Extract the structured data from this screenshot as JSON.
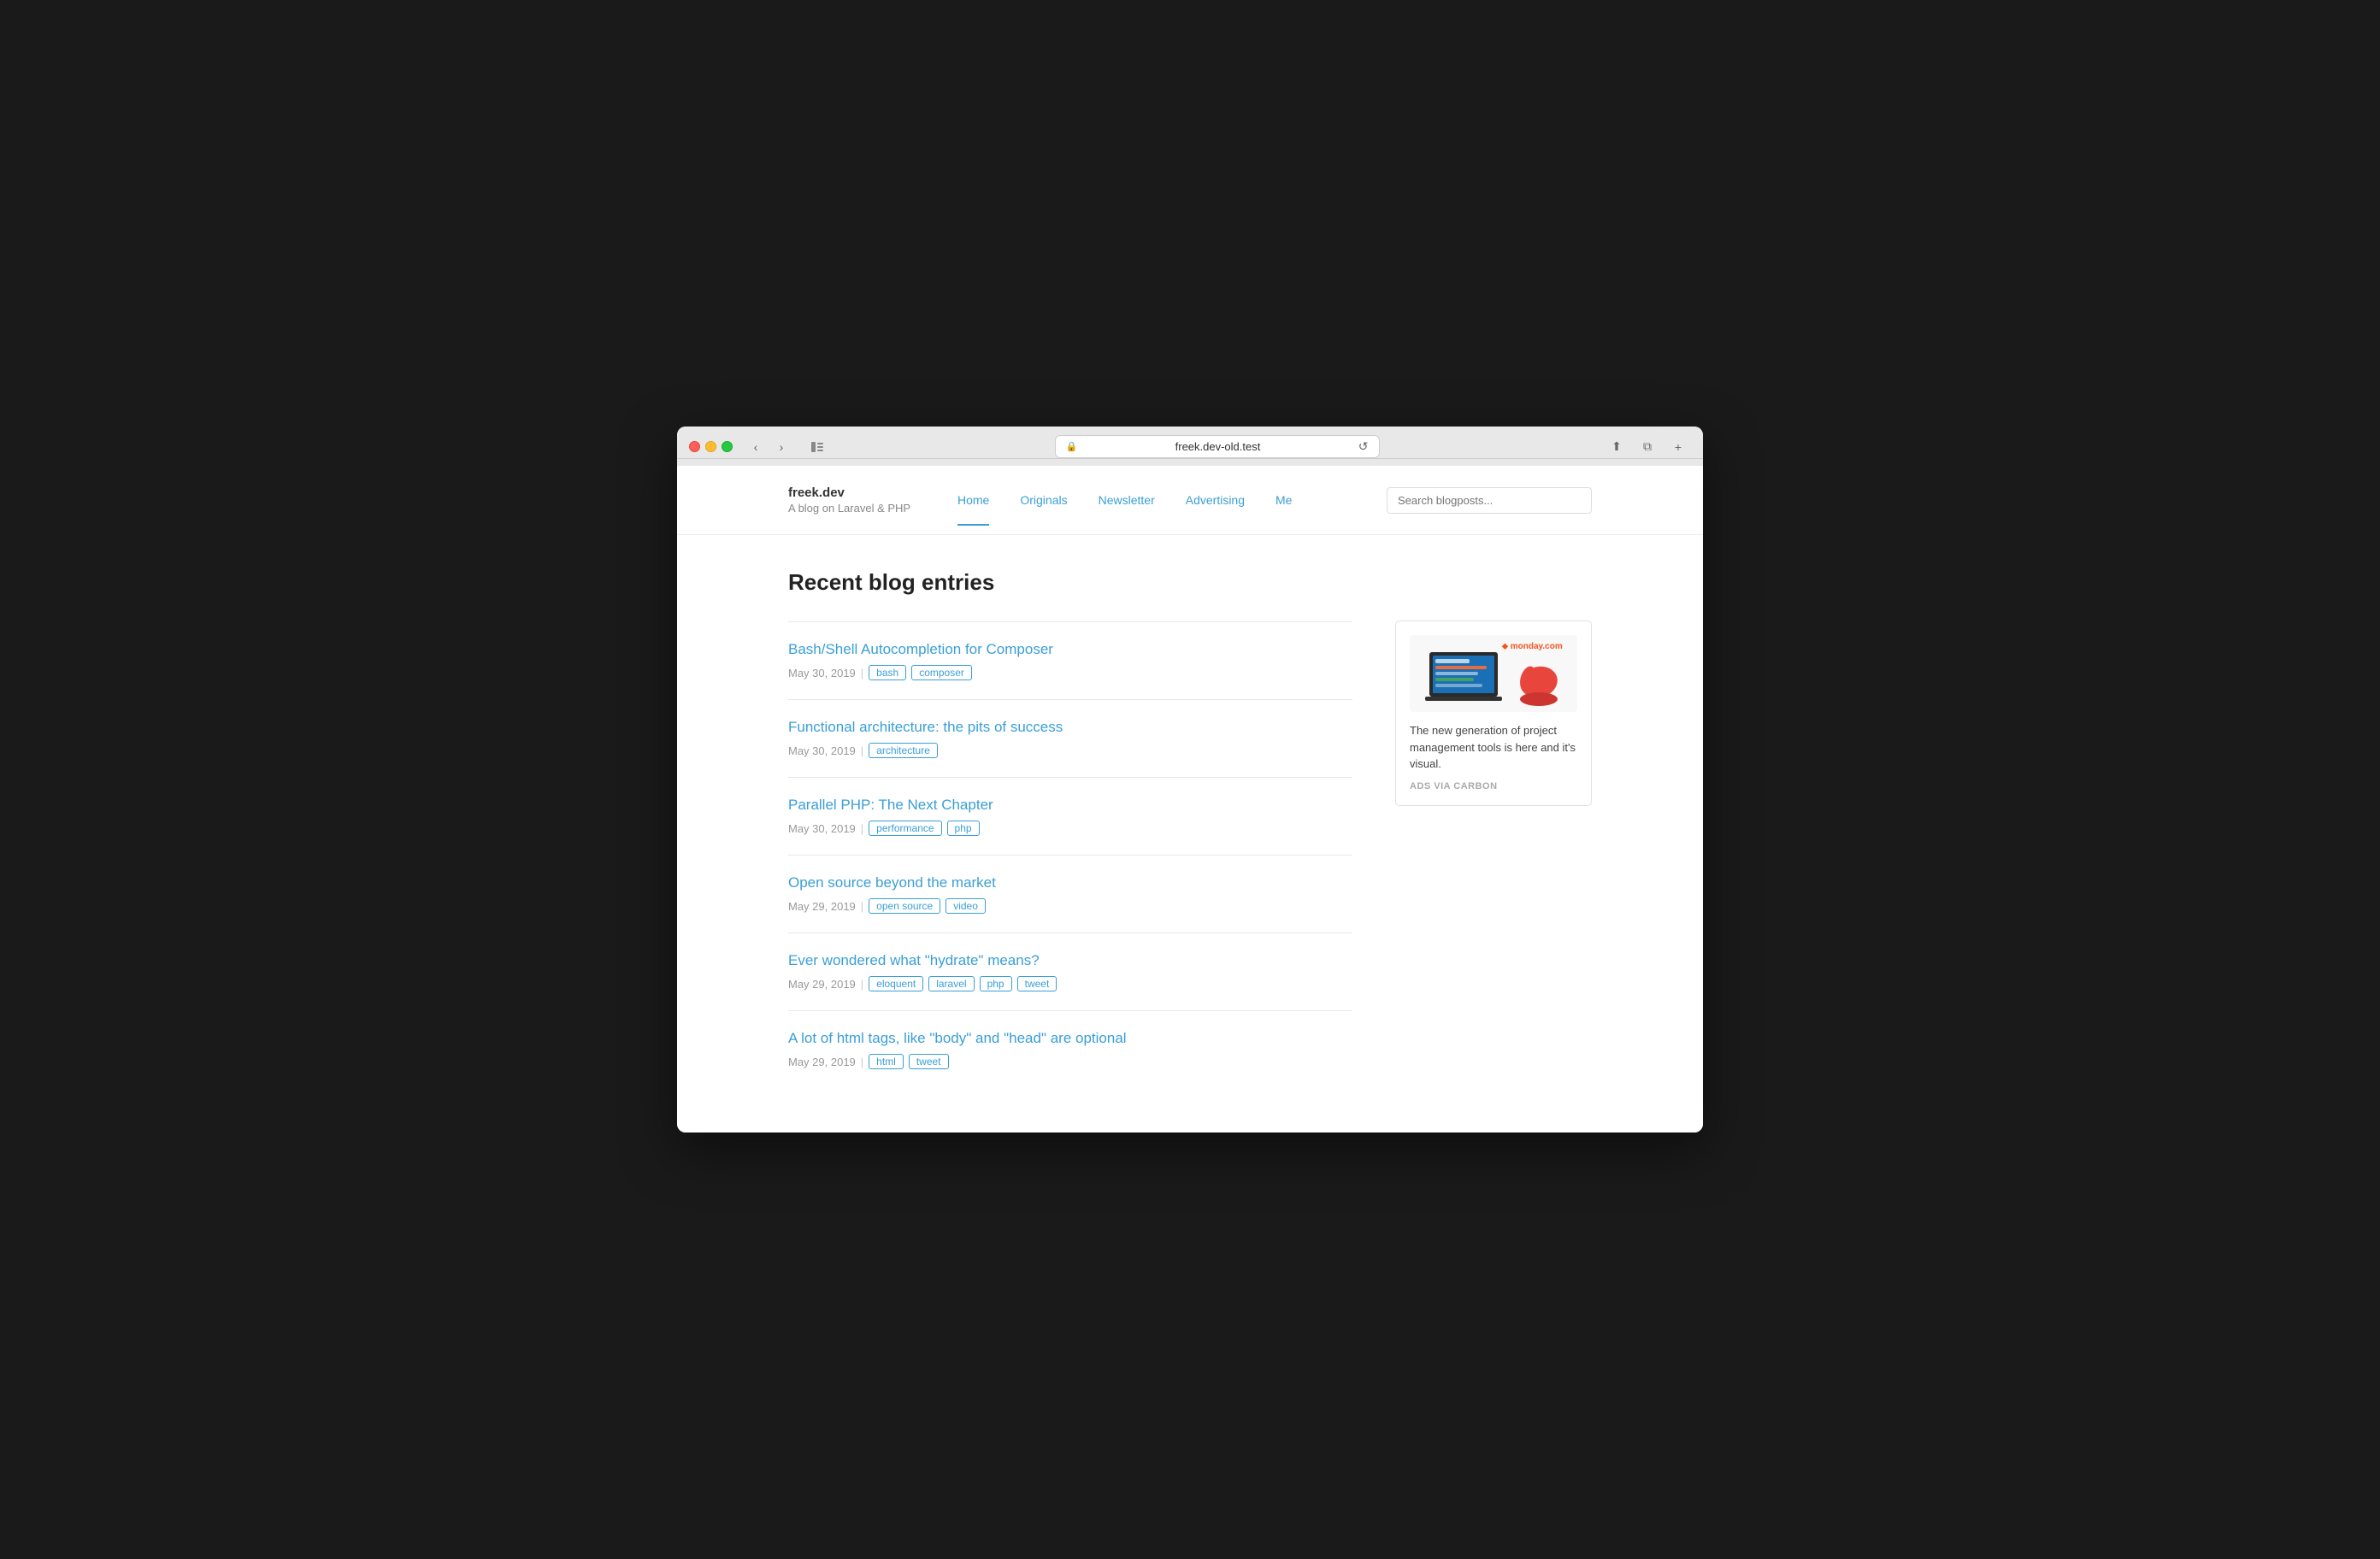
{
  "browser": {
    "url": "freek.dev-old.test",
    "back_button": "‹",
    "forward_button": "›"
  },
  "site": {
    "name": "freek.dev",
    "tagline": "A blog on Laravel & PHP"
  },
  "nav": {
    "items": [
      {
        "label": "Home",
        "active": true
      },
      {
        "label": "Originals",
        "active": false
      },
      {
        "label": "Newsletter",
        "active": false
      },
      {
        "label": "Advertising",
        "active": false
      },
      {
        "label": "Me",
        "active": false
      }
    ],
    "search_placeholder": "Search blogposts..."
  },
  "main": {
    "section_title": "Recent blog entries",
    "entries": [
      {
        "title": "Bash/Shell Autocompletion for Composer",
        "date": "May 30, 2019",
        "tags": [
          "bash",
          "composer"
        ]
      },
      {
        "title": "Functional architecture: the pits of success",
        "date": "May 30, 2019",
        "tags": [
          "architecture"
        ]
      },
      {
        "title": "Parallel PHP: The Next Chapter",
        "date": "May 30, 2019",
        "tags": [
          "performance",
          "php"
        ]
      },
      {
        "title": "Open source beyond the market",
        "date": "May 29, 2019",
        "tags": [
          "open source",
          "video"
        ]
      },
      {
        "title": "Ever wondered what \"hydrate\" means?",
        "date": "May 29, 2019",
        "tags": [
          "eloquent",
          "laravel",
          "php",
          "tweet"
        ]
      },
      {
        "title": "A lot of html tags, like \"body\" and \"head\" are optional",
        "date": "May 29, 2019",
        "tags": [
          "html",
          "tweet"
        ]
      }
    ]
  },
  "ad": {
    "text": "The new generation of project management tools is here and it's visual.",
    "via": "ADS VIA CARBON",
    "brand": "monday.com"
  }
}
